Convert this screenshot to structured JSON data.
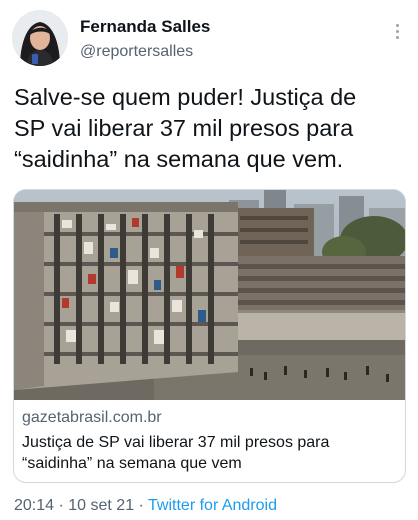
{
  "user": {
    "display_name": "Fernanda Salles",
    "handle": "@reportersalles"
  },
  "tweet": {
    "text_line1": "Salve-se quem puder! Justiça de",
    "text_line2": "SP vai liberar 37 mil presos para",
    "text_line3": "“saidinha” na semana que vem."
  },
  "card": {
    "domain": "gazetabrasil.com.br",
    "title_line1": "Justiça de SP vai liberar 37 mil presos para",
    "title_line2": "“saidinha” na semana que vem"
  },
  "footer": {
    "time": "20:14",
    "separator": " · ",
    "date": "10 set 21",
    "source": "Twitter for Android"
  },
  "icons": {
    "more": "more-vertical-icon"
  },
  "colors": {
    "text": "#0f1419",
    "secondary": "#566370",
    "link": "#1d9bf0",
    "border": "#cfd9de"
  }
}
